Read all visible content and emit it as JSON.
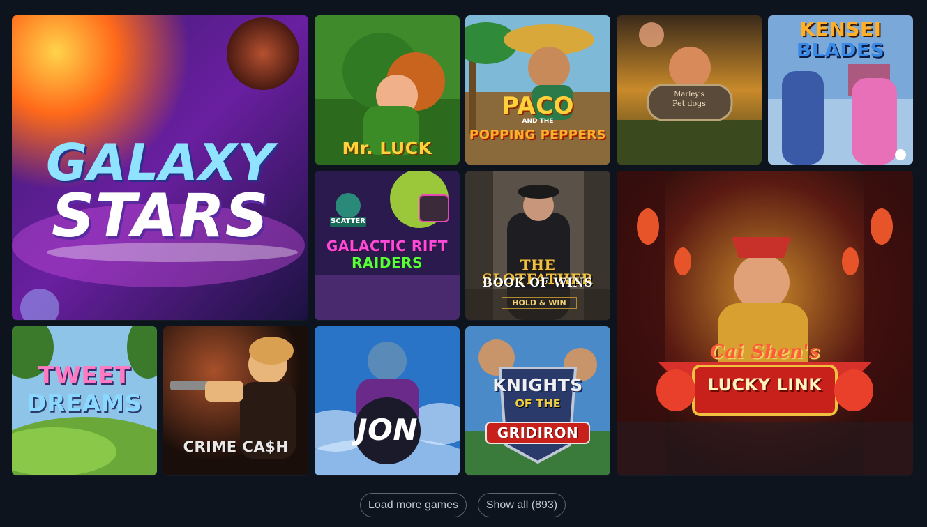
{
  "games": [
    {
      "id": "galaxy-stars",
      "title": "GALAXY",
      "title2": "STARS"
    },
    {
      "id": "mr-luck",
      "title": "Mr. LUCK"
    },
    {
      "id": "paco",
      "title": "PACO",
      "small": "AND THE",
      "title2": "POPPING PEPPERS"
    },
    {
      "id": "marleys-pet-dogs",
      "title": "Marley's",
      "title2": "Pet dogs"
    },
    {
      "id": "kensei-blades",
      "title": "KENSEI",
      "title2": "BLADES"
    },
    {
      "id": "galactic-rift-raiders",
      "badge": "SCATTER",
      "title": "GALACTIC RIFT",
      "title2": "RAIDERS"
    },
    {
      "id": "slotfather",
      "title": "THE SLOTFATHER",
      "title2": "BOOK OF WINS",
      "badge": "HOLD & WIN"
    },
    {
      "id": "cai-shens-lucky-link",
      "title": "Cai Shen's",
      "title2": "LUCKY LINK"
    },
    {
      "id": "tweet-dreams",
      "title": "TWEET",
      "title2": "DREAMS"
    },
    {
      "id": "crime-cash",
      "title": "CRIME CA$H"
    },
    {
      "id": "jon",
      "title": "JON"
    },
    {
      "id": "knights-gridiron",
      "title": "KNIGHTS",
      "small": "OF THE",
      "title2": "GRIDIRON"
    }
  ],
  "actions": {
    "load_more": "Load more games",
    "show_all": "Show all (893)"
  }
}
